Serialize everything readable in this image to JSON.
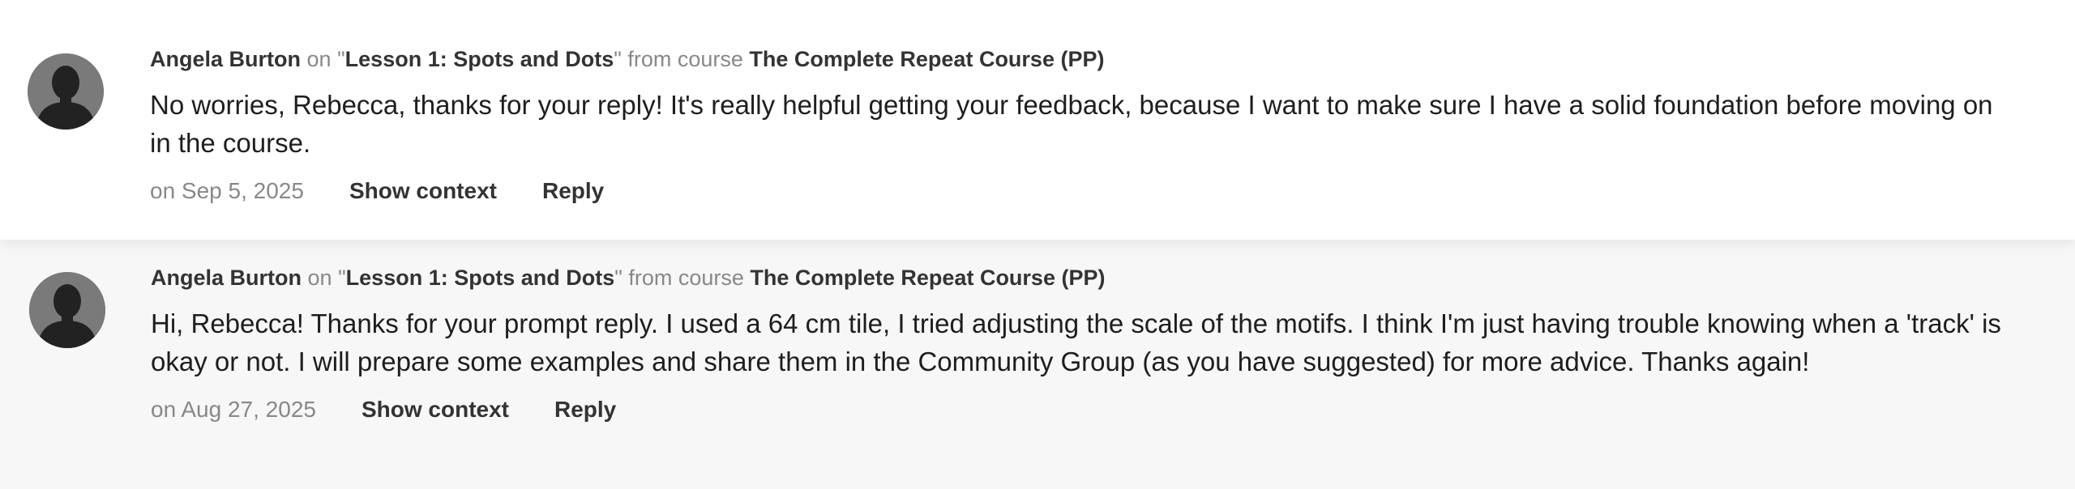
{
  "comments": [
    {
      "author": "Angela Burton",
      "on_word": "on",
      "lesson_prefix": "\"",
      "lesson": "Lesson 1: Spots and Dots",
      "lesson_suffix": "\"",
      "from_course_word": "from course",
      "course": "The Complete Repeat Course (PP)",
      "text": "No worries, Rebecca, thanks for your reply! It's really helpful getting your feedback, because I want to make sure I have a solid foundation before moving on in the course.",
      "date": "on Sep 5, 2025",
      "show_context_label": "Show context",
      "reply_label": "Reply",
      "avatar_icon": "user-silhouette-icon"
    },
    {
      "author": "Angela Burton",
      "on_word": "on",
      "lesson_prefix": "\"",
      "lesson": "Lesson 1: Spots and Dots",
      "lesson_suffix": "\"",
      "from_course_word": "from course",
      "course": "The Complete Repeat Course (PP)",
      "text": "Hi, Rebecca! Thanks for your prompt reply. I used a 64 cm tile, I tried adjusting the scale of the motifs. I think I'm just having trouble knowing when a 'track' is okay or not. I will prepare some examples and share them in the Community Group (as you have suggested) for more advice. Thanks again!",
      "date": "on Aug 27, 2025",
      "show_context_label": "Show context",
      "reply_label": "Reply",
      "avatar_icon": "user-silhouette-icon"
    }
  ],
  "colors": {
    "avatar_bg": "#7a7a7a",
    "avatar_silhouette": "#222222",
    "muted_text": "#888888",
    "strong_text": "#333333",
    "highlight_row_bg": "#ffffff",
    "page_bg": "#f7f7f7"
  }
}
